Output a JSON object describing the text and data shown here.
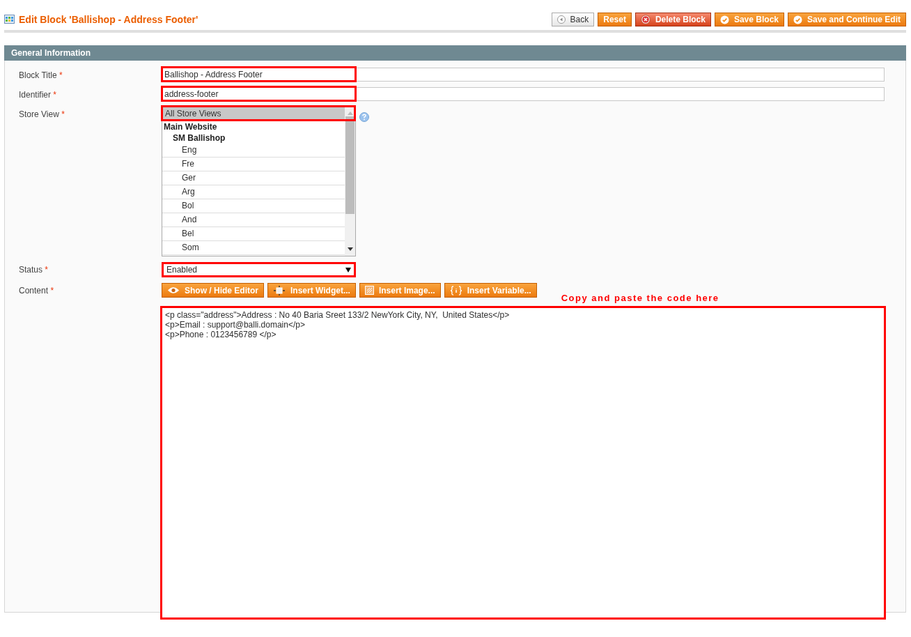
{
  "page": {
    "title": "Edit Block 'Ballishop - Address Footer'"
  },
  "buttons": [
    {
      "label": "Back",
      "kind": "back"
    },
    {
      "label": "Reset",
      "kind": "plain"
    },
    {
      "label": "Delete Block",
      "kind": "delete"
    },
    {
      "label": "Save Block",
      "kind": "save"
    },
    {
      "label": "Save and Continue Edit",
      "kind": "save"
    }
  ],
  "section": {
    "title": "General Information"
  },
  "fields": [
    {
      "kind": "text",
      "label": "Block Title",
      "required_mark": "*",
      "value": "Ballishop - Address Footer",
      "highlighted": true
    },
    {
      "kind": "text",
      "label": "Identifier",
      "required_mark": "*",
      "value": "address-footer",
      "highlighted": true
    },
    {
      "kind": "multiselect",
      "label": "Store View",
      "required_mark": "*",
      "options": [
        {
          "label": "All Store Views",
          "selected": true,
          "highlighted": true
        },
        {
          "label": "Main Website",
          "children": [
            {
              "label": "SM Ballishop",
              "children": [
                {
                  "label": "Eng",
                  "selected": false
                },
                {
                  "label": "Fre",
                  "selected": false
                },
                {
                  "label": "Ger",
                  "selected": false
                },
                {
                  "label": "Arg",
                  "selected": false
                },
                {
                  "label": "Bol",
                  "selected": false
                },
                {
                  "label": "And",
                  "selected": false
                },
                {
                  "label": "Bel",
                  "selected": false
                },
                {
                  "label": "Som",
                  "selected": false
                }
              ]
            }
          ]
        }
      ]
    },
    {
      "kind": "select",
      "label": "Status",
      "required_mark": "*",
      "value": "Enabled",
      "highlighted": true
    },
    {
      "kind": "editor",
      "label": "Content",
      "required_mark": "*",
      "toolbar": [
        {
          "label": "Show / Hide Editor",
          "kind": "eye"
        },
        {
          "label": "Insert Widget...",
          "kind": "widget"
        },
        {
          "label": "Insert Image...",
          "kind": "image"
        },
        {
          "label": "Insert Variable...",
          "kind": "variable"
        }
      ],
      "note": "Copy and paste the code here",
      "value": "<p class=\"address\">Address : No 40 Baria Sreet 133/2 NewYork City, NY,  United States</p>\n<p>Email : support@balli.domain</p>\n<p>Phone : 0123456789 </p>",
      "highlighted": true
    }
  ]
}
